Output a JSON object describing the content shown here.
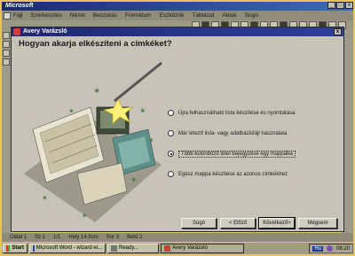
{
  "word": {
    "title": "Microsoft",
    "menu": [
      "Fájl",
      "Szerkesztés",
      "Nézet",
      "Beszúrás",
      "Formátum",
      "Eszközök",
      "Táblázat",
      "Ablak",
      "Súgó"
    ],
    "window_btn_min": "_",
    "window_btn_max": "□",
    "window_btn_close": "x"
  },
  "dialog": {
    "title": "Avery Varázsló",
    "close_label": "x",
    "heading": "Hogyan akarja elkészíteni a címkéket?",
    "options": [
      {
        "label": "Újra felhasználható lista készítése és nyomtatása",
        "selected": false
      },
      {
        "label": "Már létező lista- vagy adatbázisfájl használata",
        "selected": false
      },
      {
        "label": "Több különböző tétel bejegyzése egy mappába",
        "selected": true
      },
      {
        "label": "Egész mappa készítése az azonos címkékhez",
        "selected": false
      }
    ],
    "buttons": {
      "help": "Súgó",
      "back": "< Előző",
      "next": "Következő>",
      "cancel": "Mégsem"
    }
  },
  "statusbar": {
    "page": "Oldal 1",
    "section": "Sz 1",
    "page_of": "1/1",
    "position": "Hely 14,9cm",
    "line": "Sor 3",
    "column": "Betű 2"
  },
  "taskbar": {
    "start": "Start",
    "tasks": [
      {
        "label": "Microsoft Word - wizard el...",
        "active": false
      },
      {
        "label": "Ready...",
        "active": false
      },
      {
        "label": "Avery Varázsló",
        "active": true
      }
    ],
    "lang": "Hu",
    "clock": "08:20"
  },
  "colors": {
    "titlebar": "#1e2770",
    "dialog_bg": "#c7c3b8",
    "frame": "#e6c65a"
  }
}
